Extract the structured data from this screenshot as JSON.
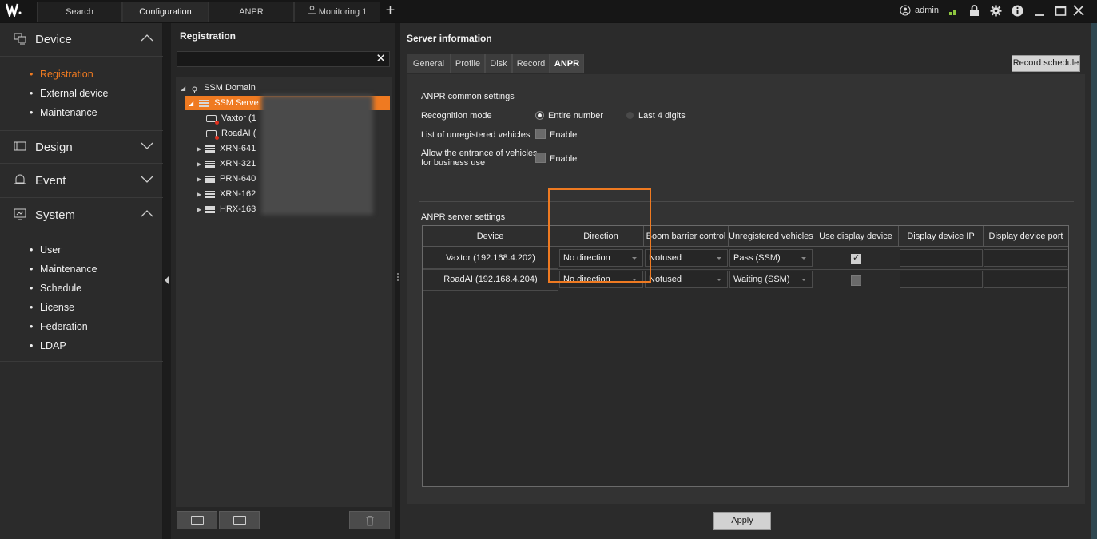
{
  "topbar": {
    "tabs": [
      "Search",
      "Configuration",
      "ANPR",
      "Monitoring 1"
    ],
    "user": "admin",
    "icons": [
      "user-icon",
      "signal-icon",
      "lock-icon",
      "gear-icon",
      "info-icon",
      "minimize-icon",
      "maximize-icon",
      "close-icon"
    ]
  },
  "nav": {
    "device": "Device",
    "device_items": [
      "Registration",
      "External device",
      "Maintenance"
    ],
    "design": "Design",
    "event": "Event",
    "system": "System",
    "system_items": [
      "User",
      "Maintenance",
      "Schedule",
      "License",
      "Federation",
      "LDAP"
    ]
  },
  "registration": {
    "title": "Registration",
    "search_value": "",
    "tree": {
      "domain": "SSM Domain",
      "server": "SSM Serve",
      "children": [
        "Vaxtor (1",
        "RoadAI (",
        "XRN-641",
        "XRN-321",
        "PRN-640",
        "XRN-162",
        "HRX-163"
      ]
    }
  },
  "server": {
    "title": "Server information",
    "tabs": [
      "General",
      "Profile",
      "Disk",
      "Record",
      "ANPR"
    ],
    "record_schedule": "Record schedule",
    "common_title": "ANPR common settings",
    "recognition_mode_label": "Recognition mode",
    "mode_entire": "Entire number",
    "mode_last4": "Last 4 digits",
    "unregistered_label": "List of unregistered vehicles",
    "enable": "Enable",
    "business_label_1": "Allow the entrance of vehicles",
    "business_label_2": "for business use",
    "server_settings_title": "ANPR server settings",
    "columns": [
      "Device",
      "Direction",
      "Boom barrier control",
      "Unregistered vehicles",
      "Use display device",
      "Display device IP",
      "Display device port"
    ],
    "rows": [
      {
        "device": "Vaxtor (192.168.4.202)",
        "direction": "No direction",
        "barrier": "Notused",
        "unregistered": "Pass (SSM)",
        "use_display": true,
        "ip": "",
        "port": ""
      },
      {
        "device": "RoadAI (192.168.4.204)",
        "direction": "No direction",
        "barrier": "Notused",
        "unregistered": "Waiting (SSM)",
        "use_display": false,
        "ip": "",
        "port": ""
      }
    ],
    "apply": "Apply"
  },
  "colors": {
    "accent": "#ef7a21",
    "panel": "#2b2b2b",
    "content": "#333333"
  }
}
